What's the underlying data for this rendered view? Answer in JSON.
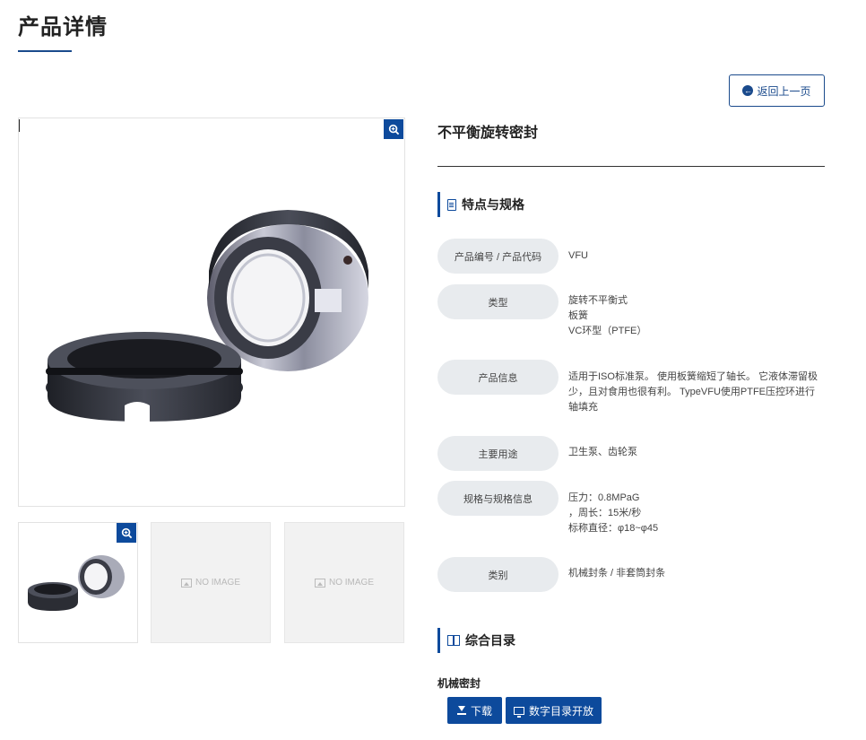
{
  "page": {
    "title": "产品详情"
  },
  "back_button": {
    "label": "返回上一页"
  },
  "product": {
    "name": "不平衡旋转密封"
  },
  "gallery": {
    "zoom_icon": "zoom-in-icon",
    "thumbnails": [
      {
        "kind": "photo"
      },
      {
        "kind": "placeholder",
        "label": "NO IMAGE"
      },
      {
        "kind": "placeholder",
        "label": "NO IMAGE"
      }
    ]
  },
  "features": {
    "heading": "特点与规格",
    "rows": [
      {
        "label": "产品编号 / 产品代码",
        "lines": [
          "VFU"
        ]
      },
      {
        "label": "类型",
        "lines": [
          "旋转不平衡式",
          "板簧",
          "VC环型（PTFE）"
        ]
      },
      {
        "label": "产品信息",
        "lines": [
          "适用于ISO标准泵。 使用板簧缩短了轴长。 它液体滞留极少，且对食用也很有利。 TypeVFU使用PTFE压控环进行轴填充"
        ]
      },
      {
        "label": "主要用途",
        "lines": [
          "卫生泵、齿轮泵"
        ]
      },
      {
        "label": "规格与规格信息",
        "lines": [
          "压力：0.8MPaG",
          "，周长：15米/秒",
          "标称直径：φ18~φ45"
        ]
      },
      {
        "label": "类别",
        "lines": [
          "机械封条 / 非套筒封条"
        ]
      }
    ]
  },
  "catalog": {
    "heading": "综合目录",
    "item_title": "机械密封",
    "download_label": "下载",
    "digital_label": "数字目录开放"
  },
  "colors": {
    "accent": "#0d4a9c",
    "pill_bg": "#e8ebee"
  }
}
